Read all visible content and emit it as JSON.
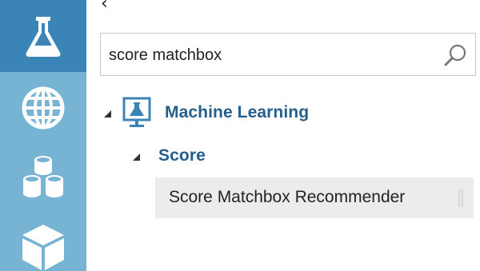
{
  "sidebar": {
    "items": [
      {
        "icon": "flask-icon",
        "active": true
      },
      {
        "icon": "globe-icon",
        "active": false
      },
      {
        "icon": "datasets-icon",
        "active": false
      },
      {
        "icon": "cube-icon",
        "active": false
      }
    ]
  },
  "panel": {
    "collapse_glyph": "‹"
  },
  "search": {
    "value": "score matchbox",
    "placeholder": ""
  },
  "tree": {
    "category": {
      "label": "Machine Learning",
      "icon": "machine-learning-icon"
    },
    "subcategory": {
      "label": "Score"
    },
    "results": [
      {
        "label": "Score Matchbox Recommender"
      }
    ]
  },
  "colors": {
    "rail_bg": "#77b3d2",
    "rail_active": "#3b84b7",
    "category_text": "#245f8c",
    "result_bg": "#ececec"
  }
}
